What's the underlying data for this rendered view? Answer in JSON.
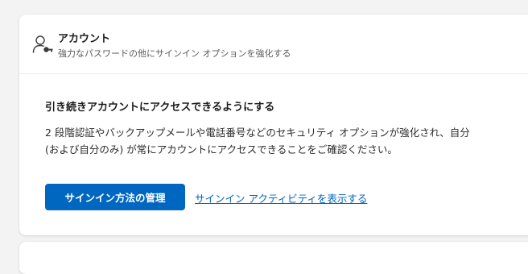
{
  "account_card": {
    "icon": "person-key-icon",
    "title": "アカウント",
    "subtitle": "強力なパスワードの他にサインイン オプションを強化する",
    "section_heading": "引き続きアカウントにアクセスできるようにする",
    "description": "2 段階認証やバックアップメールや電話番号などのセキュリティ オプションが強化され、自分 (および自分のみ) が常にアカウントにアクセスできることをご確認ください。",
    "manage_button_label": "サインイン方法の管理",
    "activity_link_label": "サインイン アクティビティを表示する"
  },
  "colors": {
    "accent": "#0067c0",
    "background": "#f3f3f3",
    "card": "#ffffff"
  }
}
